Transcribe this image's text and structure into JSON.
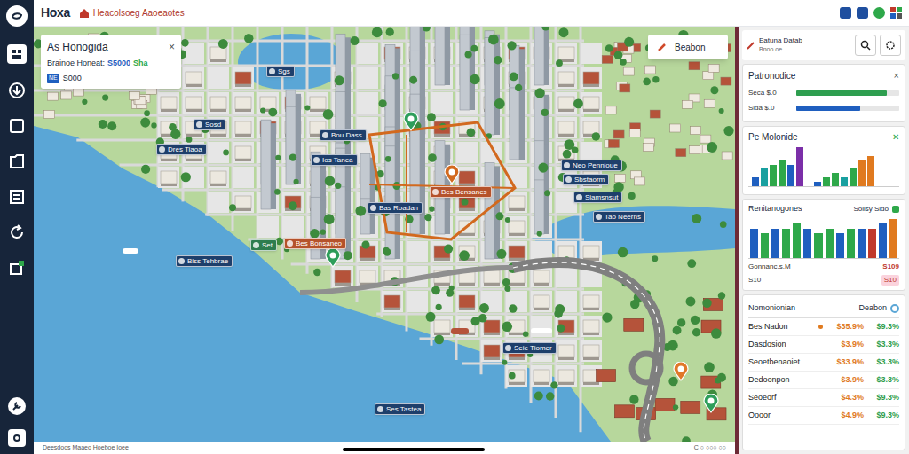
{
  "app": {
    "logo": "Hoxa",
    "subtitle": "Heacolsoeg Aaoeaotes"
  },
  "map_card": {
    "title": "As Honogida",
    "close": "×",
    "label": "Brainoe Honeat:",
    "amount": "S5000",
    "extra": "Sha",
    "badge": "NE",
    "value": "S000"
  },
  "edit_button": {
    "label": "Beabon"
  },
  "map_labels": [
    {
      "text": "Sgs",
      "color": "#1e3f6b"
    },
    {
      "text": "Sosd",
      "color": "#1e3f6b"
    },
    {
      "text": "Dres Tiaoa",
      "color": "#1e3f6b"
    },
    {
      "text": "Bou Dass",
      "color": "#1e3f6b"
    },
    {
      "text": "Ios Tanea",
      "color": "#1e3f6b"
    },
    {
      "text": "Bes Bensanes",
      "color": "#b5522b"
    },
    {
      "text": "Bas Roadan",
      "color": "#1e3f6b"
    },
    {
      "text": "Neo Pennioue",
      "color": "#1e3f6b"
    },
    {
      "text": "Sbstaorm",
      "color": "#1e3f6b"
    },
    {
      "text": "Siamsnsut",
      "color": "#1e3f6b"
    },
    {
      "text": "Tao Neerns",
      "color": "#1e3f6b"
    },
    {
      "text": "Set",
      "color": "#2e7d4f"
    },
    {
      "text": "Bes Bonsaneo",
      "color": "#b5522b"
    },
    {
      "text": "Biss Tehbrae",
      "color": "#1e3f6b"
    },
    {
      "text": "Seie Tiomer",
      "color": "#1e3f6b"
    },
    {
      "text": "Ses Tastea",
      "color": "#1e3f6b"
    }
  ],
  "pins": [
    {
      "color": "#2e9e5b"
    },
    {
      "color": "#2e9e5b"
    },
    {
      "color": "#d2691e"
    },
    {
      "color": "#2e9e5b"
    },
    {
      "color": "#e0782a"
    }
  ],
  "footer": {
    "left": "Deesdoos Maaeo Hoeboe Ioee",
    "right": "C ○ ○○○ ○○"
  },
  "panel": {
    "title": "Eatuna Datab",
    "subtitle": "Bnoo oe",
    "summary": {
      "title": "Patronodice",
      "close": "×",
      "rows": [
        {
          "label": "Seca $.0",
          "level": 0.88,
          "color": "#2e9e4f"
        },
        {
          "label": "Sida $.0",
          "level": 0.62,
          "color": "#1f5fbf"
        }
      ]
    },
    "chart1": {
      "title": "Pe Molonide",
      "icon": "✕",
      "groups": [
        {
          "values": [
            2,
            4,
            5,
            6,
            5,
            9
          ],
          "colors": [
            "#1f5fbf",
            "#19a0a0",
            "#2ea84a",
            "#2ea84a",
            "#1f5fbf",
            "#7b2fa8"
          ]
        },
        {
          "values": [
            1,
            2,
            3,
            2,
            4,
            6,
            7
          ],
          "colors": [
            "#1f5fbf",
            "#2ea84a",
            "#2ea84a",
            "#19a0a0",
            "#2ea84a",
            "#e07a1f",
            "#e07a1f"
          ]
        }
      ]
    },
    "chart2": {
      "title": "Renitanogones",
      "right": "Solisy Sldo",
      "values": [
        6,
        5,
        6,
        6,
        7,
        6,
        5,
        6,
        5,
        6,
        6,
        6,
        7,
        8
      ],
      "colors": [
        "#1f5fbf",
        "#2ea84a",
        "#1f5fbf",
        "#2ea84a",
        "#2ea84a",
        "#1f5fbf",
        "#2ea84a",
        "#2ea84a",
        "#1f5fbf",
        "#2ea84a",
        "#1f5fbf",
        "#c0392b",
        "#1f5fbf",
        "#e07a1f"
      ],
      "footer_left": [
        "Gonnanc.s.M",
        "S10"
      ],
      "footer_right": [
        "S109",
        "S10"
      ]
    },
    "table": {
      "title": "Nomonionian",
      "action": "Deabon",
      "rows": [
        {
          "name": "Bes Nadon",
          "a": "$35.9%",
          "b": "$9.3%",
          "marked": true
        },
        {
          "name": "Dasdosion",
          "a": "$3.9%",
          "b": "$3.3%",
          "marked": false
        },
        {
          "name": "Seoetbenaoiet",
          "a": "$33.9%",
          "b": "$3.3%",
          "marked": false
        },
        {
          "name": "Dedoonpon",
          "a": "$3.9%",
          "b": "$3.3%",
          "marked": false
        },
        {
          "name": "Seoeorf",
          "a": "$4.3%",
          "b": "$9.3%",
          "marked": false
        },
        {
          "name": "Oooor",
          "a": "$4.9%",
          "b": "$9.3%",
          "marked": false
        }
      ]
    }
  }
}
